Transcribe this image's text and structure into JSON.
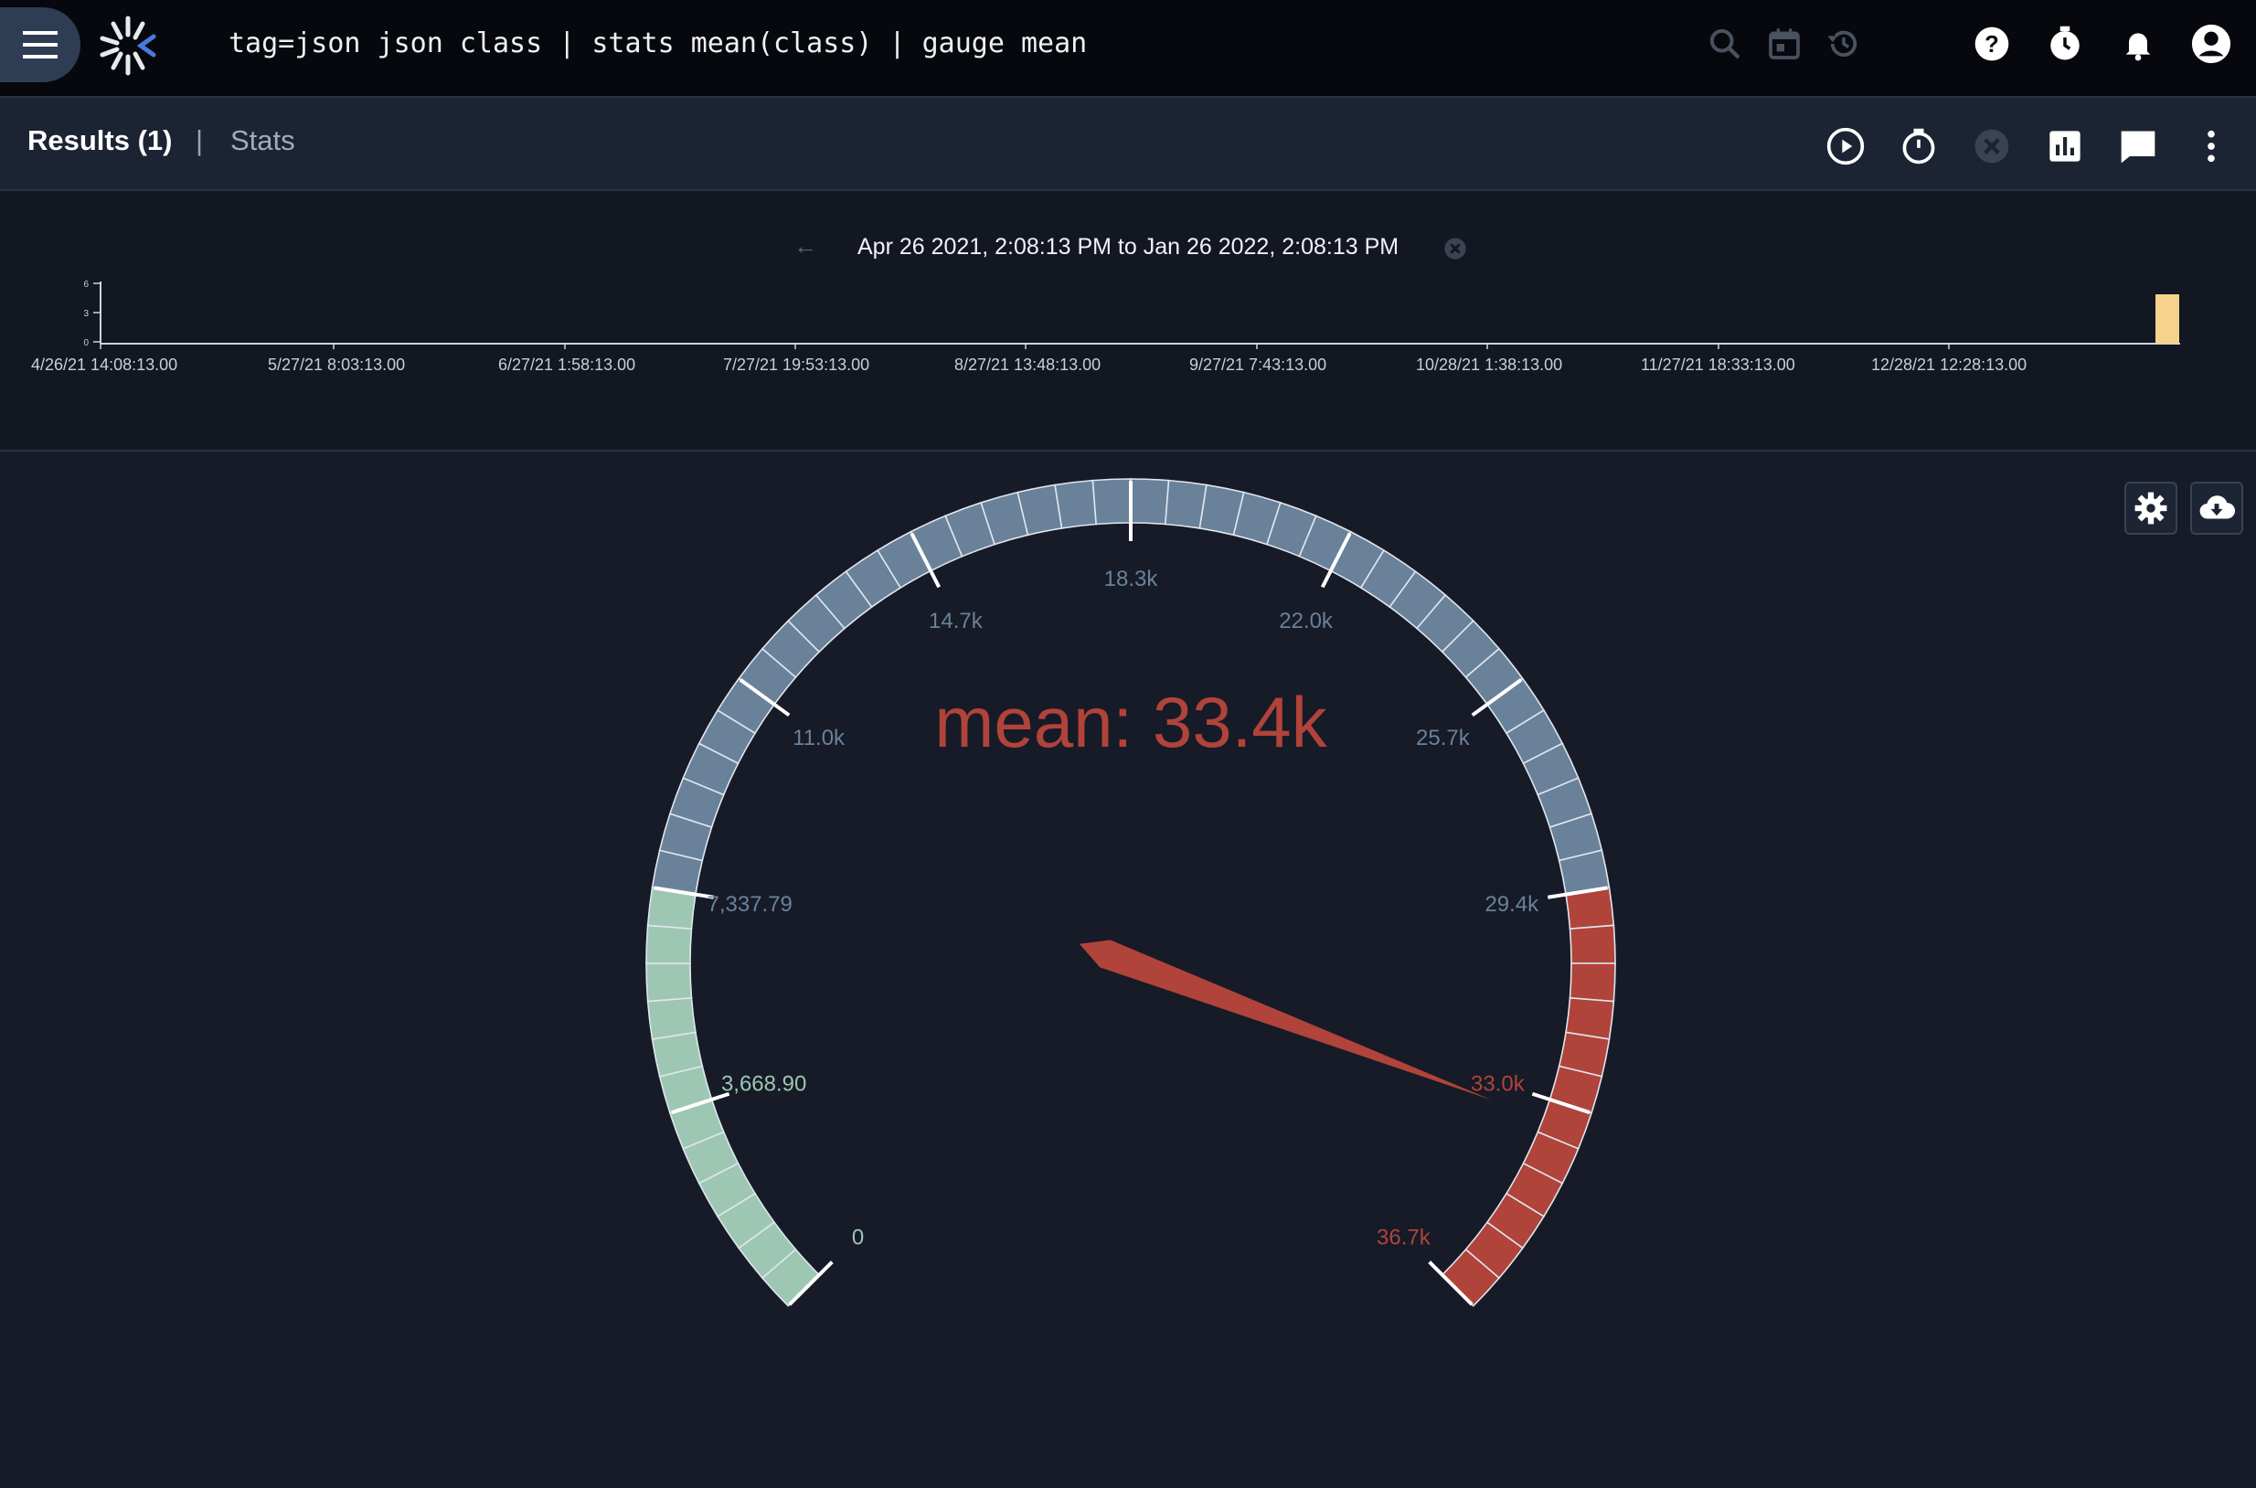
{
  "header": {
    "query": "tag=json json class | stats mean(class) | gauge mean",
    "icons": [
      "menu-icon",
      "logo",
      "search-icon",
      "calendar-icon",
      "history-icon",
      "help-icon",
      "timer-icon",
      "bell-icon",
      "account-icon"
    ]
  },
  "toolbar": {
    "results_label": "Results (1)",
    "separator": "|",
    "stats_label": "Stats",
    "icons": [
      "play-icon",
      "stopwatch-icon",
      "cancel-icon",
      "chart-icon",
      "comment-icon",
      "more-vert-icon"
    ]
  },
  "timeline": {
    "range_text": "Apr 26 2021, 2:08:13 PM to Jan 26 2022, 2:08:13 PM",
    "prev_arrow": "←",
    "y_ticks": [
      "6",
      "3",
      "0"
    ],
    "x_labels": [
      "4/26/21 14:08:13.00",
      "5/27/21 8:03:13.00",
      "6/27/21 1:58:13.00",
      "7/27/21 19:53:13.00",
      "8/27/21 13:48:13.00",
      "9/27/21 7:43:13.00",
      "10/28/21 1:38:13.00",
      "11/27/21 18:33:13.00",
      "12/28/21 12:28:13.00"
    ],
    "bar_color": "#f7d28a"
  },
  "gauge": {
    "title_prefix": "mean: ",
    "title_value": "33.4k",
    "value": 33400,
    "min": 0,
    "max": 36700,
    "labels": [
      "0",
      "3,668.90",
      "7,337.79",
      "11.0k",
      "14.7k",
      "18.3k",
      "22.0k",
      "25.7k",
      "29.4k",
      "33.0k",
      "36.7k"
    ],
    "band_colors": {
      "low": "#9ec7b3",
      "mid": "#6a819a",
      "high": "#b0433a"
    },
    "band_breaks": [
      7337.79,
      29400
    ]
  },
  "panel_icons": [
    "settings-icon",
    "cloud-download-icon"
  ]
}
